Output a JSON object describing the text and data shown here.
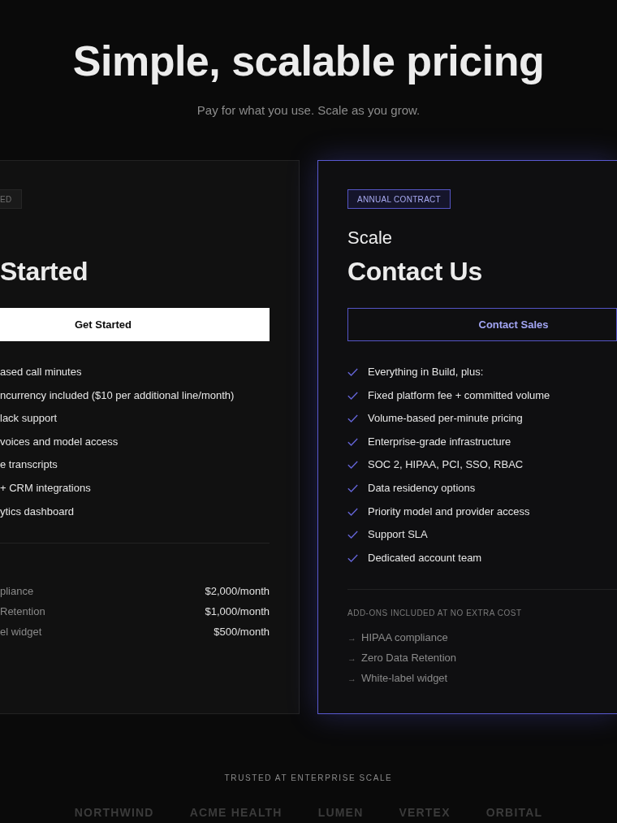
{
  "header": {
    "title": "Simple, scalable pricing",
    "subtitle": "Pay for what you use. Scale as you grow."
  },
  "plans": [
    {
      "featured": false,
      "badge": "ED",
      "price": "Started",
      "cta": "Get Started",
      "checkmarks": false,
      "features": [
        "ased call minutes",
        "ncurrency included ($10 per additional line/month)",
        "lack support",
        "voices and model access",
        "e transcripts",
        "+ CRM integrations",
        "ytics dashboard"
      ],
      "addons": [
        {
          "kind": "price_row",
          "label": "pliance",
          "price": "$2,000/month"
        },
        {
          "kind": "price_row",
          "label": "Retention",
          "price": "$1,000/month"
        },
        {
          "kind": "price_row",
          "label": "el widget",
          "price": "$500/month"
        }
      ]
    },
    {
      "featured": true,
      "badge": "ANNUAL CONTRACT",
      "name": "Scale",
      "price": "Contact Us",
      "cta": "Contact Sales",
      "checkmarks": true,
      "features": [
        "Everything in Build, plus:",
        "Fixed platform fee + committed volume",
        "Volume-based per-minute pricing",
        "Enterprise-grade infrastructure",
        "SOC 2, HIPAA, PCI, SSO, RBAC",
        "Data residency options",
        "Priority model and provider access",
        "Support SLA",
        "Dedicated account team"
      ],
      "addons_title": "ADD-ONS INCLUDED AT NO EXTRA COST",
      "addons": [
        {
          "kind": "arrow_row",
          "arrow": "→",
          "label": "HIPAA compliance"
        },
        {
          "kind": "arrow_row",
          "arrow": "→",
          "label": "Zero Data Retention"
        },
        {
          "kind": "arrow_row",
          "arrow": "→",
          "label": "White-label widget"
        }
      ]
    }
  ],
  "trust": {
    "label": "TRUSTED AT ENTERPRISE SCALE",
    "logos": [
      "NORTHWIND",
      "ACME HEALTH",
      "LUMEN",
      "VERTEX",
      "ORBITAL"
    ]
  }
}
